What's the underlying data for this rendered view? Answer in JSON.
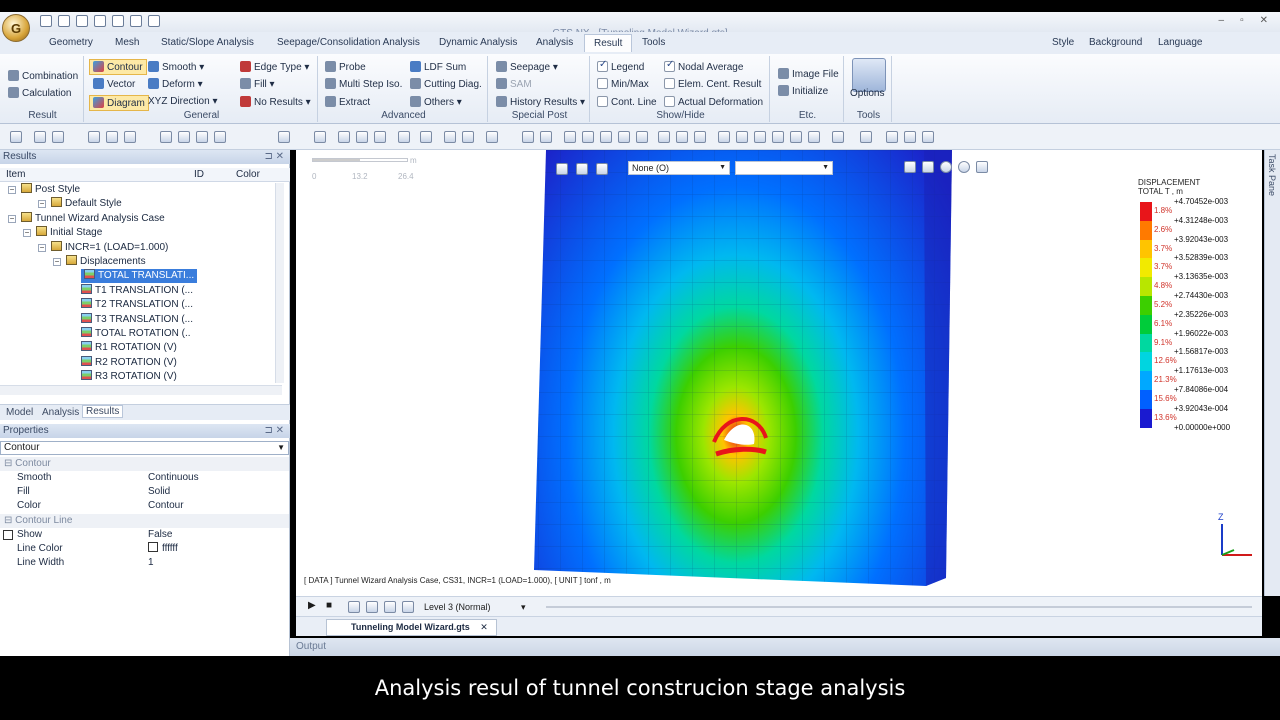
{
  "window": {
    "title": "GTS NX - [Tunneling Model Wizard.gts]"
  },
  "menu_tabs": [
    "Geometry",
    "Mesh",
    "Static/Slope Analysis",
    "Seepage/Consolidation Analysis",
    "Dynamic Analysis",
    "Analysis",
    "Result",
    "Tools"
  ],
  "menu_right": [
    "Style",
    "Background",
    "Language"
  ],
  "ribbon": {
    "result": {
      "label": "Result",
      "combination": "Combination",
      "calculation": "Calculation"
    },
    "general": {
      "label": "General",
      "contour": "Contour",
      "vector": "Vector",
      "diagram": "Diagram",
      "smooth": "Smooth",
      "deform": "Deform",
      "xyz_direction": "XYZ Direction",
      "edge_type": "Edge Type",
      "fill": "Fill",
      "no_results": "No Results"
    },
    "advanced": {
      "label": "Advanced",
      "probe": "Probe",
      "multi_step": "Multi Step Iso.",
      "extract": "Extract",
      "ldf_sum": "LDF Sum",
      "cutting_diag": "Cutting Diag.",
      "others": "Others"
    },
    "special_post": {
      "label": "Special Post",
      "seepage": "Seepage",
      "sam": "SAM",
      "history": "History Results"
    },
    "show_hide": {
      "label": "Show/Hide",
      "legend": "Legend",
      "min_max": "Min/Max",
      "cont_line": "Cont. Line",
      "nodal_average": "Nodal Average",
      "elem_cent": "Elem. Cent. Result",
      "actual_deformation": "Actual Deformation"
    },
    "etc": {
      "label": "Etc.",
      "image_file": "Image File",
      "initialize": "Initialize"
    },
    "tools": {
      "label": "Tools",
      "options": "Options"
    }
  },
  "results_panel": {
    "title": "Results",
    "columns": [
      "Item",
      "ID",
      "Color"
    ],
    "tree": [
      {
        "label": "Post Style",
        "indent": 1,
        "icon": "folder"
      },
      {
        "label": "Default Style",
        "indent": 3,
        "icon": "folder"
      },
      {
        "label": "Tunnel Wizard Analysis Case",
        "indent": 1,
        "icon": "folder"
      },
      {
        "label": "Initial Stage",
        "indent": 2,
        "icon": "folder"
      },
      {
        "label": "INCR=1 (LOAD=1.000)",
        "indent": 3,
        "icon": "folder"
      },
      {
        "label": "Displacements",
        "indent": 4,
        "icon": "folder"
      },
      {
        "label": "TOTAL TRANSLATI...",
        "indent": 5,
        "icon": "result",
        "selected": true
      },
      {
        "label": "T1 TRANSLATION (...",
        "indent": 5,
        "icon": "result"
      },
      {
        "label": "T2 TRANSLATION (...",
        "indent": 5,
        "icon": "result"
      },
      {
        "label": "T3 TRANSLATION (...",
        "indent": 5,
        "icon": "result"
      },
      {
        "label": "TOTAL ROTATION (..",
        "indent": 5,
        "icon": "result"
      },
      {
        "label": "R1 ROTATION (V)",
        "indent": 5,
        "icon": "result"
      },
      {
        "label": "R2 ROTATION (V)",
        "indent": 5,
        "icon": "result"
      },
      {
        "label": "R3 ROTATION (V)",
        "indent": 5,
        "icon": "result"
      }
    ],
    "bottom_tabs": [
      "Model",
      "Analysis",
      "Results"
    ]
  },
  "properties_panel": {
    "title": "Properties",
    "selector": "Contour",
    "sections": [
      {
        "name": "Contour",
        "rows": [
          [
            "Smooth",
            "Continuous"
          ],
          [
            "Fill",
            "Solid"
          ],
          [
            "Color",
            "Contour"
          ]
        ]
      },
      {
        "name": "Contour Line",
        "rows": [
          [
            "Show",
            "False"
          ],
          [
            "Line Color",
            "ffffff"
          ],
          [
            "Line Width",
            "1"
          ]
        ]
      }
    ]
  },
  "viewport": {
    "section_combo": "None (O)",
    "scale_ticks": [
      "0",
      "13.2",
      "26.4"
    ],
    "scale_unit": "m",
    "status": "[ DATA ]  Tunnel Wizard Analysis Case,  CS31,  INCR=1 (LOAD=1.000),   [ UNIT ]   tonf , m",
    "axis_label": "Z",
    "task_pane": "Task Pane"
  },
  "legend": {
    "title": "DISPLACEMENT",
    "subtitle": "TOTAL T , m",
    "values": [
      "+4.70452e-003",
      "+4.31248e-003",
      "+3.92043e-003",
      "+3.52839e-003",
      "+3.13635e-003",
      "+2.74430e-003",
      "+2.35226e-003",
      "+1.96022e-003",
      "+1.56817e-003",
      "+1.17613e-003",
      "+7.84086e-004",
      "+3.92043e-004",
      "+0.00000e+000"
    ],
    "percents": [
      "1.8%",
      "2.6%",
      "3.7%",
      "3.7%",
      "4.8%",
      "5.2%",
      "6.1%",
      "9.1%",
      "12.6%",
      "21.3%",
      "15.6%",
      "13.6%"
    ],
    "colors": [
      "#e8151a",
      "#ff7a00",
      "#ffc400",
      "#f2ea00",
      "#b8e600",
      "#3ccf00",
      "#00cc3a",
      "#00d8a0",
      "#00d5e0",
      "#00a8ff",
      "#0060ff",
      "#1a1ad0"
    ]
  },
  "animation": {
    "level": "Level 3 (Normal)"
  },
  "document_tab": "Tunneling Model Wizard.gts",
  "output_title": "Output",
  "caption": "Analysis resul of tunnel construcion stage analysis"
}
